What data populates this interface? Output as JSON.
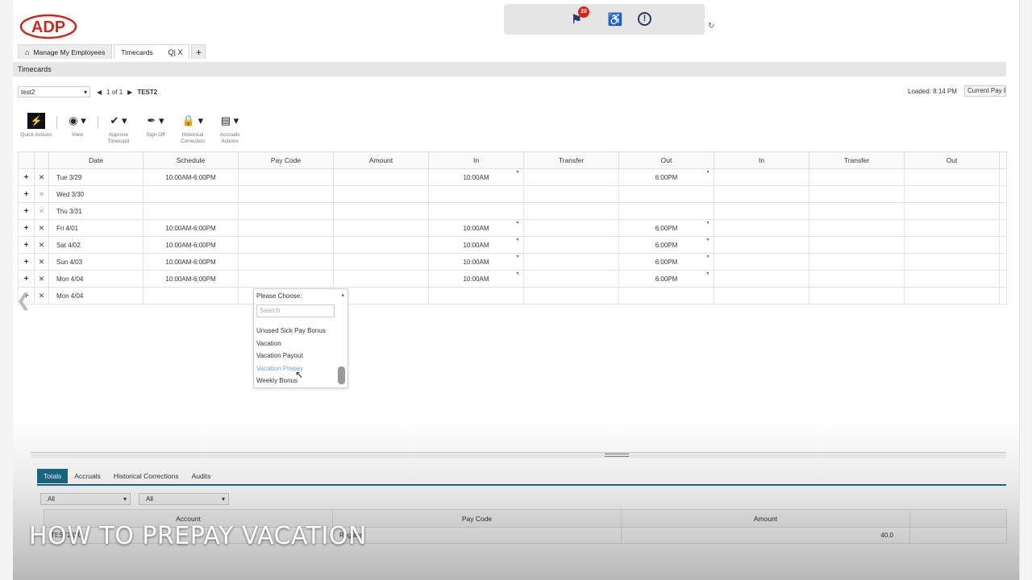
{
  "brand": {
    "logo_text": "ADP",
    "color": "#d0271d"
  },
  "header": {
    "notification_count": "20"
  },
  "tabs": [
    {
      "label": "Manage My Employees"
    },
    {
      "label": "Timecards",
      "tools": "Q| X"
    },
    {
      "label": "+"
    }
  ],
  "section_title": "Timecards",
  "filter": {
    "employee_select": "test2",
    "pager_text": "1 of 1",
    "employee_name": "TEST2",
    "loaded": "Loaded: 8:14 PM",
    "pay_period": "Current Pay P"
  },
  "toolbar": [
    {
      "label": "Quick Actions",
      "icon": "lightning-icon"
    },
    {
      "label": "View",
      "icon": "eye-icon"
    },
    {
      "label": "Approve Timecard",
      "icon": "checkmark-icon"
    },
    {
      "label": "Sign Off",
      "icon": "signature-icon"
    },
    {
      "label": "Historical Correction",
      "icon": "lock-icon"
    },
    {
      "label": "Accruals Actions",
      "icon": "accruals-icon"
    }
  ],
  "grid": {
    "columns": [
      "Date",
      "Schedule",
      "Pay Code",
      "Amount",
      "In",
      "Transfer",
      "Out",
      "In",
      "Transfer",
      "Out"
    ],
    "rows": [
      {
        "date": "Tue 3/29",
        "schedule": "10:00AM-6:00PM",
        "in": "10:00AM",
        "out": "6:00PM"
      },
      {
        "date": "Wed 3/30",
        "schedule": "",
        "in": "",
        "out": ""
      },
      {
        "date": "Thu 3/31",
        "schedule": "",
        "in": "",
        "out": ""
      },
      {
        "date": "Fri 4/01",
        "schedule": "10:00AM-6:00PM",
        "in": "10:00AM",
        "out": "6:00PM"
      },
      {
        "date": "Sat 4/02",
        "schedule": "10:00AM-6:00PM",
        "in": "10:00AM",
        "out": "6:00PM"
      },
      {
        "date": "Sun 4/03",
        "schedule": "10:00AM-6:00PM",
        "in": "10:00AM",
        "out": "6:00PM"
      },
      {
        "date": "Mon 4/04",
        "schedule": "10:00AM-6:00PM",
        "in": "10:00AM",
        "out": "6:00PM"
      },
      {
        "date": "Mon 4/04",
        "schedule": "",
        "in": "",
        "out": ""
      }
    ]
  },
  "paycode_dropdown": {
    "placeholder": "Please Choose:",
    "search_placeholder": "Search",
    "options": [
      "Unused Sick Pay Bonus",
      "Vacation",
      "Vacation Payout",
      "Vacation Prepay",
      "Weekly Bonus"
    ],
    "highlighted": "Vacation Prepay"
  },
  "bottom": {
    "tabs": [
      "Totals",
      "Accruals",
      "Historical Corrections",
      "Audits"
    ],
    "filters": [
      "All",
      "All"
    ],
    "columns": [
      "Account",
      "Pay Code",
      "Amount"
    ],
    "row": {
      "account": "TEST2/0/0",
      "paycode": "Regular",
      "amount": "40.0"
    }
  },
  "caption": "HOW TO PREPAY VACATION"
}
